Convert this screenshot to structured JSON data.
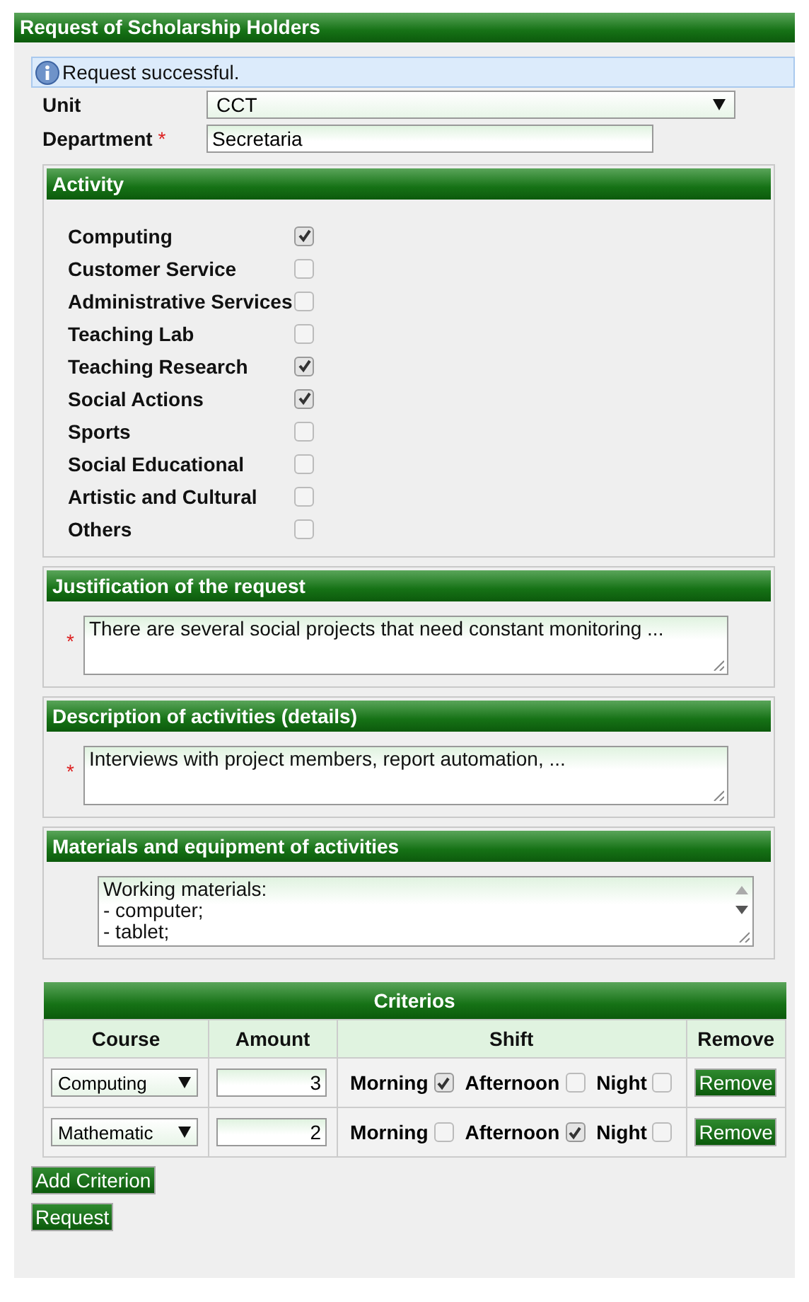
{
  "title": "Request of Scholarship Holders",
  "message": "Request successful.",
  "unit": {
    "label": "Unit",
    "value": "CCT"
  },
  "department": {
    "label": "Department",
    "required_mark": "*",
    "value": "Secretaria"
  },
  "activity": {
    "title": "Activity",
    "items": [
      {
        "label": "Computing",
        "checked": true
      },
      {
        "label": "Customer Service",
        "checked": false
      },
      {
        "label": "Administrative Services",
        "checked": false
      },
      {
        "label": "Teaching Lab",
        "checked": false
      },
      {
        "label": "Teaching Research",
        "checked": true
      },
      {
        "label": "Social Actions",
        "checked": true
      },
      {
        "label": "Sports",
        "checked": false
      },
      {
        "label": "Social Educational",
        "checked": false
      },
      {
        "label": "Artistic and Cultural",
        "checked": false
      },
      {
        "label": "Others",
        "checked": false
      }
    ]
  },
  "text_sections": [
    {
      "title": "Justification of the request",
      "required_mark": "*",
      "lines": [
        "There are several social projects that need constant monitoring ..."
      ]
    },
    {
      "title": "Description of activities (details)",
      "required_mark": "*",
      "lines": [
        "Interviews with project members, report automation, ..."
      ]
    },
    {
      "title": "Materials and equipment of activities",
      "lines": [
        "Working materials:",
        "- computer;",
        "- tablet;"
      ]
    }
  ],
  "criteria": {
    "title": "Criterios",
    "columns": [
      "Course",
      "Amount",
      "Shift",
      "Remove"
    ],
    "rows": [
      {
        "course": "Computing",
        "amount": "3",
        "shifts": [
          {
            "label": "Morning",
            "checked": true
          },
          {
            "label": "Afternoon",
            "checked": false
          },
          {
            "label": "Night",
            "checked": false
          }
        ],
        "remove": "Remove"
      },
      {
        "course": "Mathematic",
        "amount": "2",
        "shifts": [
          {
            "label": "Morning",
            "checked": false
          },
          {
            "label": "Afternoon",
            "checked": true
          },
          {
            "label": "Night",
            "checked": false
          }
        ],
        "remove": "Remove"
      }
    ]
  },
  "buttons": [
    "Add Criterion",
    "Request"
  ]
}
